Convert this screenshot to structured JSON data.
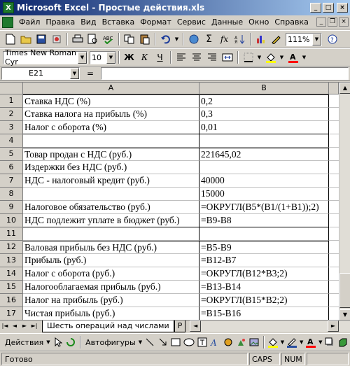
{
  "window": {
    "title": "Microsoft Excel - Простые действия.xls",
    "app_icon": "excel-icon",
    "minimize": "_",
    "maximize": "□",
    "close": "×"
  },
  "menu": [
    "Файл",
    "Правка",
    "Вид",
    "Вставка",
    "Формат",
    "Сервис",
    "Данные",
    "Окно",
    "Справка"
  ],
  "standard_toolbar": {
    "zoom": "111%",
    "icons": [
      "new-icon",
      "open-icon",
      "save-icon",
      "permission-icon",
      "print-icon",
      "print-preview-icon",
      "spelling-icon",
      "copy-icon",
      "paste-icon",
      "undo-icon",
      "hyperlink-icon",
      "autosum-icon",
      "function-icon",
      "sort-icon",
      "chart-icon",
      "help-icon"
    ]
  },
  "formatting_toolbar": {
    "font_name": "Times New Roman Cyr",
    "font_size": "10",
    "bold": "Ж",
    "italic": "К",
    "underline": "Ч",
    "icons": [
      "align-left-icon",
      "align-center-icon",
      "align-right-icon",
      "merge-icon",
      "borders-icon",
      "fill-color-icon",
      "font-color-icon"
    ],
    "fill_color": "#ffff00",
    "font_color": "#ff0000"
  },
  "formula_bar": {
    "name_box": "E21",
    "equals": "=",
    "formula": ""
  },
  "sheet": {
    "columns": [
      "A",
      "B"
    ],
    "rows": [
      {
        "n": "1",
        "a": "Ставка НДС (%)",
        "b": "0,2"
      },
      {
        "n": "2",
        "a": "Ставка налога на прибыль (%)",
        "b": "0,3"
      },
      {
        "n": "3",
        "a": "Налог с оборота (%)",
        "b": "0,01"
      },
      {
        "n": "4",
        "a": "",
        "b": ""
      },
      {
        "n": "5",
        "a": "Товар продан с НДС (руб.)",
        "b": "221645,02"
      },
      {
        "n": "6",
        "a": "Издержки без НДС (руб.)",
        "b": ""
      },
      {
        "n": "7",
        "a": "НДС - налоговый кредит (руб.)",
        "b": "40000"
      },
      {
        "n": "8",
        "a": "",
        "b": "15000"
      },
      {
        "n": "9",
        "a": "Налоговое обязательство (руб.)",
        "b": "=ОКРУГЛ(B5*(B1/(1+B1));2)"
      },
      {
        "n": "10",
        "a": "НДС подлежит уплате в бюджет (руб.)",
        "b": "=B9-B8"
      },
      {
        "n": "11",
        "a": "",
        "b": ""
      },
      {
        "n": "12",
        "a": "Валовая прибыль без НДС (руб.)",
        "b": "=B5-B9"
      },
      {
        "n": "13",
        "a": "Прибыль (руб.)",
        "b": "=B12-B7"
      },
      {
        "n": "14",
        "a": "Налог с оборота (руб.)",
        "b": "=ОКРУГЛ(B12*B3;2)"
      },
      {
        "n": "15",
        "a": "Налогооблагаемая прибыль (руб.)",
        "b": "=B13-B14"
      },
      {
        "n": "16",
        "a": "Налог на прибыль (руб.)",
        "b": "=ОКРУГЛ(B15*B2;2)"
      },
      {
        "n": "17",
        "a": "Чистая прибыль (руб.)",
        "b": "=B15-B16"
      }
    ]
  },
  "tabs": {
    "active": "Шесть операций над числами",
    "other": "Р"
  },
  "drawing_toolbar": {
    "actions": "Действия",
    "autoshapes": "Автофигуры"
  },
  "status": {
    "text": "Готово",
    "caps": "CAPS",
    "num": "NUM"
  }
}
